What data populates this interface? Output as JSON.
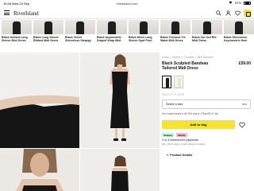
{
  "status": {
    "time": "15:48",
    "date": "Wed 24 Sep",
    "url": "riverisland.com",
    "battery": "57%"
  },
  "header": {
    "logo": "RiverIsland"
  },
  "carousel": [
    {
      "label": "Black Knitted Long Sleeve Midi Dress"
    },
    {
      "label": "Black Long Sleeve Ribbed Midi Dress"
    },
    {
      "label": "Black Velvet Sleeveless Strappy"
    },
    {
      "label": "Black Asymmetric Draped Wrap Midi"
    },
    {
      "label": "Black Mesh Long Sleeve Spot Print"
    },
    {
      "label": "Black Textured Tie Waist Midi Dress"
    },
    {
      "label": "Black Cut Out Rib Midi Dress"
    },
    {
      "label": "Black Sleeveless Asymmetric Hem"
    }
  ],
  "product": {
    "breadcrumbs": "Home > Women > Dresses > Midi Dresses",
    "title": "Black Sculpted Bandeau Tailored Midi Dress",
    "price": "£59.00",
    "swatch_colors": [
      "#1a1a1a",
      "#efe6c8"
    ],
    "size_label": "SELECT A SIZE",
    "size_placeholder": "Select a size",
    "fit_note": "Our model wears a UK 8/S and is 178cm/5'10\" tall",
    "add_to_bag": "Add to bag",
    "clearpay_badge": "clearpay",
    "klarna_badge": "Klarna.",
    "pay_text": "3 or 4 interest-free payments",
    "pay_sub": "18+, T&Cs apply. Credit subject to status.",
    "details_label": "Product Details"
  },
  "colors": {
    "accent": "#f5e32d"
  }
}
